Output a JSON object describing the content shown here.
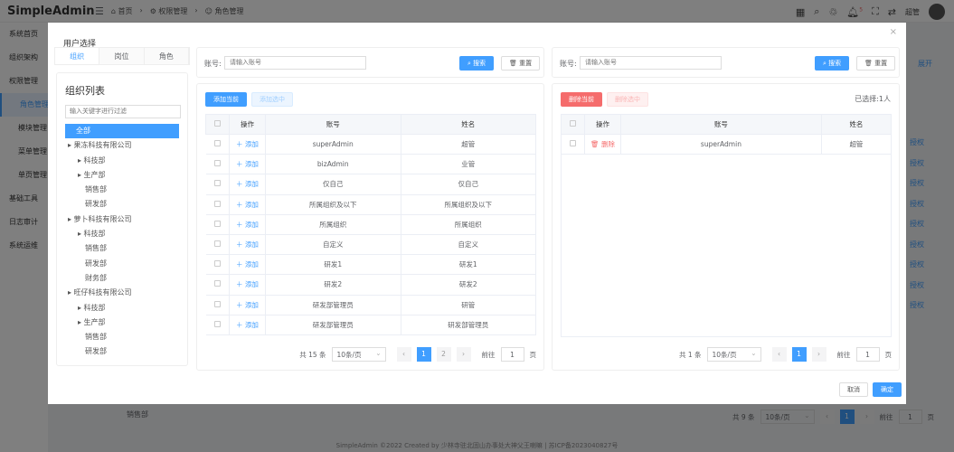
{
  "app": {
    "title": "SimpleAdmin",
    "breadcrumb": [
      "首页",
      "权限管理",
      "角色管理"
    ],
    "user": "超管",
    "badge": "5"
  },
  "sidebar": [
    "系统首页",
    "组织架构",
    "权限管理",
    "角色管理",
    "模块管理",
    "菜单管理",
    "单页管理",
    "基础工具",
    "日志审计",
    "系统运维"
  ],
  "background": {
    "expand": "展开",
    "grant": "授权",
    "tree_item": "销售部",
    "total": "共 9 条",
    "page_size": "10条/页",
    "page": "1",
    "goto": "前往",
    "goto_val": "1",
    "page_unit": "页"
  },
  "footer": "SimpleAdmin ©2022 Created by 少林寺驻北固山办事处大神父王喇嘛 | 苏ICP备2023040827号",
  "modal": {
    "title": "用户选择",
    "close": "×",
    "tabs": [
      "组织",
      "岗位",
      "角色"
    ],
    "org": {
      "title": "组织列表",
      "filter_placeholder": "输入关键字进行过滤",
      "tree": [
        {
          "l": 0,
          "t": "全部"
        },
        {
          "l": 1,
          "t": "▸ 果冻科技有限公司"
        },
        {
          "l": 2,
          "t": "▸ 科技部"
        },
        {
          "l": 2,
          "t": "▸ 生产部"
        },
        {
          "l": 3,
          "t": "销售部"
        },
        {
          "l": 3,
          "t": "研发部"
        },
        {
          "l": 1,
          "t": "▸ 萝卜科技有限公司"
        },
        {
          "l": 2,
          "t": "▸ 科技部"
        },
        {
          "l": 3,
          "t": "销售部"
        },
        {
          "l": 3,
          "t": "研发部"
        },
        {
          "l": 3,
          "t": "财务部"
        },
        {
          "l": 1,
          "t": "▸ 旺仔科技有限公司"
        },
        {
          "l": 2,
          "t": "▸ 科技部"
        },
        {
          "l": 2,
          "t": "▸ 生产部"
        },
        {
          "l": 3,
          "t": "销售部"
        },
        {
          "l": 3,
          "t": "研发部"
        }
      ]
    },
    "left": {
      "account_label": "账号:",
      "account_placeholder": "请输入账号",
      "search": "搜索",
      "reset": "重置",
      "add_page": "添加当前",
      "add_selected": "添加选中",
      "columns": [
        "操作",
        "账号",
        "姓名"
      ],
      "action": "添加",
      "rows": [
        [
          "superAdmin",
          "超管"
        ],
        [
          "bizAdmin",
          "业管"
        ],
        [
          "仅自己",
          "仅自己"
        ],
        [
          "所属组织及以下",
          "所属组织及以下"
        ],
        [
          "所属组织",
          "所属组织"
        ],
        [
          "自定义",
          "自定义"
        ],
        [
          "研发1",
          "研发1"
        ],
        [
          "研发2",
          "研发2"
        ],
        [
          "研发部管理员",
          "研管"
        ],
        [
          "研发部管理员",
          "研发部管理员"
        ]
      ],
      "total": "共 15 条",
      "page_size": "10条/页",
      "pages": [
        "1",
        "2"
      ],
      "goto": "前往",
      "goto_val": "1",
      "page_unit": "页"
    },
    "right": {
      "account_label": "账号:",
      "account_placeholder": "请输入账号",
      "search": "搜索",
      "reset": "重置",
      "del_page": "删除当前",
      "del_selected": "删除选中",
      "selected": "已选择:1人",
      "columns": [
        "操作",
        "账号",
        "姓名"
      ],
      "action": "删除",
      "rows": [
        [
          "superAdmin",
          "超管"
        ]
      ],
      "total": "共 1 条",
      "page_size": "10条/页",
      "pages": [
        "1"
      ],
      "goto": "前往",
      "goto_val": "1",
      "page_unit": "页"
    },
    "cancel": "取消",
    "confirm": "确定"
  },
  "colors": {
    "primary": "#409eff",
    "danger": "#f56c6c"
  }
}
